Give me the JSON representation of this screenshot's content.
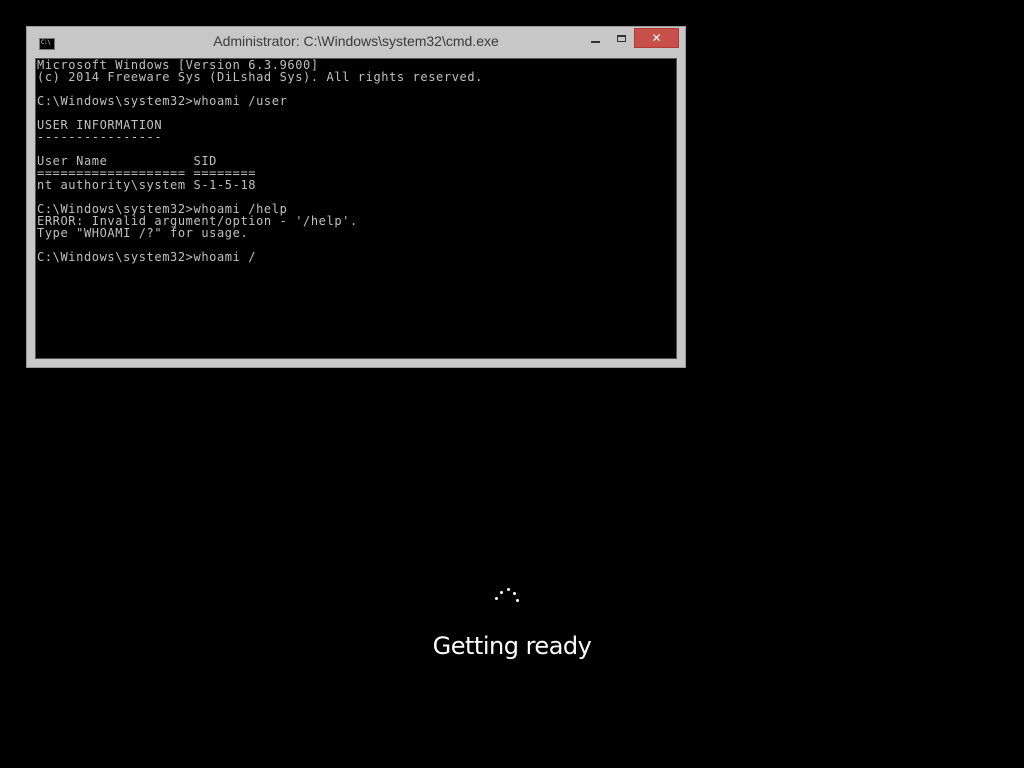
{
  "window": {
    "title": "Administrator: C:\\Windows\\system32\\cmd.exe",
    "icon": "cmd-icon",
    "icon_glyph": "C:\\",
    "buttons": {
      "minimize": "minimize-icon",
      "maximize": "maximize-icon",
      "close": "close-icon",
      "close_glyph": "✕"
    },
    "close_color": "#c7504a"
  },
  "console": {
    "lines": [
      "Microsoft Windows [Version 6.3.9600]",
      "(c) 2014 Freeware Sys (DiLshad Sys). All rights reserved.",
      "",
      "C:\\Windows\\system32>whoami /user",
      "",
      "USER INFORMATION",
      "----------------",
      "",
      "User Name           SID",
      "=================== ========",
      "nt authority\\system S-1-5-18",
      "",
      "C:\\Windows\\system32>whoami /help",
      "ERROR: Invalid argument/option - '/help'.",
      "Type \"WHOAMI /?\" for usage.",
      "",
      "C:\\Windows\\system32>whoami /"
    ]
  },
  "setup": {
    "status": "Getting ready",
    "spinner_icon": "loading-spinner-icon"
  }
}
